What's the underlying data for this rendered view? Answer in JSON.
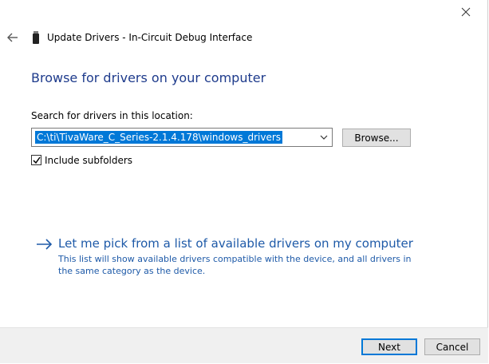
{
  "window": {
    "title": "Update Drivers - In-Circuit Debug Interface"
  },
  "icons": {
    "close": "close-icon",
    "back": "back-arrow-icon",
    "device": "usb-device-icon",
    "dropdown": "chevron-down-icon",
    "checkmark": "checkmark-icon",
    "link_arrow": "arrow-right-icon"
  },
  "main": {
    "heading": "Browse for drivers on your computer",
    "search_label": "Search for drivers in this location:",
    "path_value": "C:\\ti\\TivaWare_C_Series-2.1.4.178\\windows_drivers",
    "browse_label": "Browse...",
    "include_subfolders": {
      "label": "Include subfolders",
      "checked": true
    },
    "pick_link": "Let me pick from a list of available drivers on my computer",
    "pick_description": "This list will show available drivers compatible with the device, and all drivers in the same category as the device."
  },
  "footer": {
    "next_label": "Next",
    "cancel_label": "Cancel"
  },
  "colors": {
    "heading": "#1e3b8c",
    "link": "#1e5aa8",
    "selection": "#0078d7",
    "footer_bg": "#f0f0f0",
    "button_bg": "#e1e1e1"
  }
}
